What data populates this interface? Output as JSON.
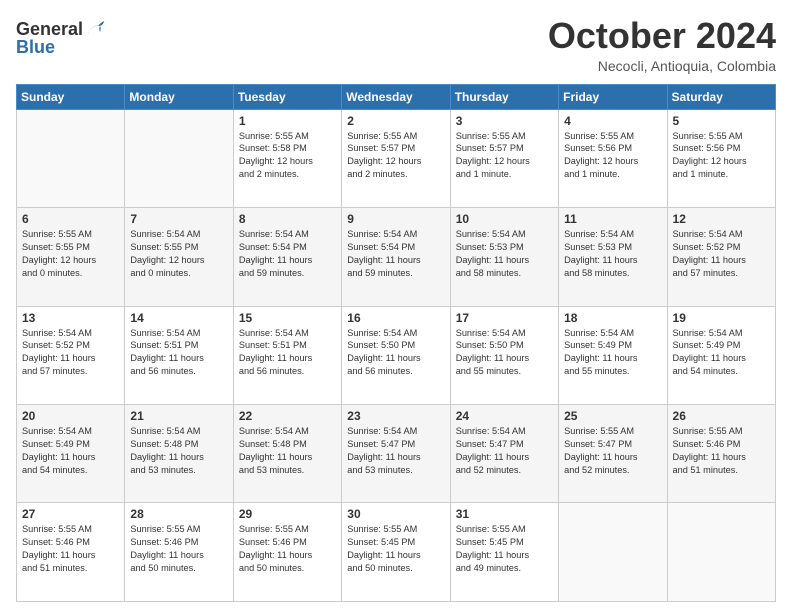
{
  "header": {
    "logo_general": "General",
    "logo_blue": "Blue",
    "title": "October 2024",
    "subtitle": "Necocli, Antioquia, Colombia"
  },
  "weekdays": [
    "Sunday",
    "Monday",
    "Tuesday",
    "Wednesday",
    "Thursday",
    "Friday",
    "Saturday"
  ],
  "weeks": [
    [
      {
        "day": "",
        "info": ""
      },
      {
        "day": "",
        "info": ""
      },
      {
        "day": "1",
        "info": "Sunrise: 5:55 AM\nSunset: 5:58 PM\nDaylight: 12 hours\nand 2 minutes."
      },
      {
        "day": "2",
        "info": "Sunrise: 5:55 AM\nSunset: 5:57 PM\nDaylight: 12 hours\nand 2 minutes."
      },
      {
        "day": "3",
        "info": "Sunrise: 5:55 AM\nSunset: 5:57 PM\nDaylight: 12 hours\nand 1 minute."
      },
      {
        "day": "4",
        "info": "Sunrise: 5:55 AM\nSunset: 5:56 PM\nDaylight: 12 hours\nand 1 minute."
      },
      {
        "day": "5",
        "info": "Sunrise: 5:55 AM\nSunset: 5:56 PM\nDaylight: 12 hours\nand 1 minute."
      }
    ],
    [
      {
        "day": "6",
        "info": "Sunrise: 5:55 AM\nSunset: 5:55 PM\nDaylight: 12 hours\nand 0 minutes."
      },
      {
        "day": "7",
        "info": "Sunrise: 5:54 AM\nSunset: 5:55 PM\nDaylight: 12 hours\nand 0 minutes."
      },
      {
        "day": "8",
        "info": "Sunrise: 5:54 AM\nSunset: 5:54 PM\nDaylight: 11 hours\nand 59 minutes."
      },
      {
        "day": "9",
        "info": "Sunrise: 5:54 AM\nSunset: 5:54 PM\nDaylight: 11 hours\nand 59 minutes."
      },
      {
        "day": "10",
        "info": "Sunrise: 5:54 AM\nSunset: 5:53 PM\nDaylight: 11 hours\nand 58 minutes."
      },
      {
        "day": "11",
        "info": "Sunrise: 5:54 AM\nSunset: 5:53 PM\nDaylight: 11 hours\nand 58 minutes."
      },
      {
        "day": "12",
        "info": "Sunrise: 5:54 AM\nSunset: 5:52 PM\nDaylight: 11 hours\nand 57 minutes."
      }
    ],
    [
      {
        "day": "13",
        "info": "Sunrise: 5:54 AM\nSunset: 5:52 PM\nDaylight: 11 hours\nand 57 minutes."
      },
      {
        "day": "14",
        "info": "Sunrise: 5:54 AM\nSunset: 5:51 PM\nDaylight: 11 hours\nand 56 minutes."
      },
      {
        "day": "15",
        "info": "Sunrise: 5:54 AM\nSunset: 5:51 PM\nDaylight: 11 hours\nand 56 minutes."
      },
      {
        "day": "16",
        "info": "Sunrise: 5:54 AM\nSunset: 5:50 PM\nDaylight: 11 hours\nand 56 minutes."
      },
      {
        "day": "17",
        "info": "Sunrise: 5:54 AM\nSunset: 5:50 PM\nDaylight: 11 hours\nand 55 minutes."
      },
      {
        "day": "18",
        "info": "Sunrise: 5:54 AM\nSunset: 5:49 PM\nDaylight: 11 hours\nand 55 minutes."
      },
      {
        "day": "19",
        "info": "Sunrise: 5:54 AM\nSunset: 5:49 PM\nDaylight: 11 hours\nand 54 minutes."
      }
    ],
    [
      {
        "day": "20",
        "info": "Sunrise: 5:54 AM\nSunset: 5:49 PM\nDaylight: 11 hours\nand 54 minutes."
      },
      {
        "day": "21",
        "info": "Sunrise: 5:54 AM\nSunset: 5:48 PM\nDaylight: 11 hours\nand 53 minutes."
      },
      {
        "day": "22",
        "info": "Sunrise: 5:54 AM\nSunset: 5:48 PM\nDaylight: 11 hours\nand 53 minutes."
      },
      {
        "day": "23",
        "info": "Sunrise: 5:54 AM\nSunset: 5:47 PM\nDaylight: 11 hours\nand 53 minutes."
      },
      {
        "day": "24",
        "info": "Sunrise: 5:54 AM\nSunset: 5:47 PM\nDaylight: 11 hours\nand 52 minutes."
      },
      {
        "day": "25",
        "info": "Sunrise: 5:55 AM\nSunset: 5:47 PM\nDaylight: 11 hours\nand 52 minutes."
      },
      {
        "day": "26",
        "info": "Sunrise: 5:55 AM\nSunset: 5:46 PM\nDaylight: 11 hours\nand 51 minutes."
      }
    ],
    [
      {
        "day": "27",
        "info": "Sunrise: 5:55 AM\nSunset: 5:46 PM\nDaylight: 11 hours\nand 51 minutes."
      },
      {
        "day": "28",
        "info": "Sunrise: 5:55 AM\nSunset: 5:46 PM\nDaylight: 11 hours\nand 50 minutes."
      },
      {
        "day": "29",
        "info": "Sunrise: 5:55 AM\nSunset: 5:46 PM\nDaylight: 11 hours\nand 50 minutes."
      },
      {
        "day": "30",
        "info": "Sunrise: 5:55 AM\nSunset: 5:45 PM\nDaylight: 11 hours\nand 50 minutes."
      },
      {
        "day": "31",
        "info": "Sunrise: 5:55 AM\nSunset: 5:45 PM\nDaylight: 11 hours\nand 49 minutes."
      },
      {
        "day": "",
        "info": ""
      },
      {
        "day": "",
        "info": ""
      }
    ]
  ]
}
